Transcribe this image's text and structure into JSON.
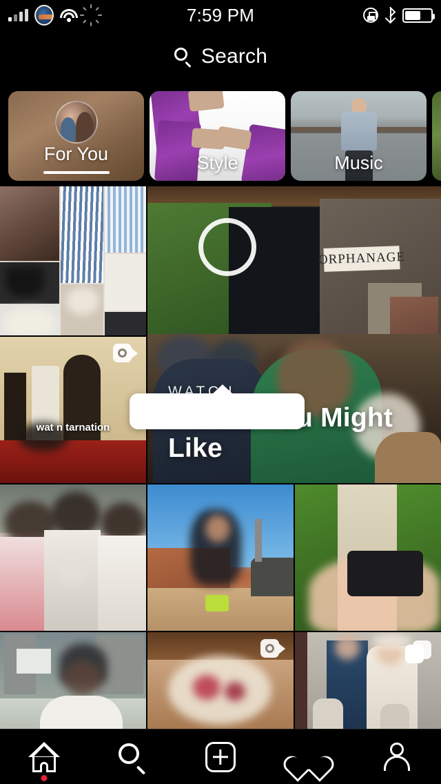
{
  "status_bar": {
    "time": "7:59 PM",
    "carrier_icon": "carrier-logo-mets",
    "signal_icon": "signal-bars-icon",
    "wifi_icon": "wifi-icon",
    "activity_icon": "activity-spinner-icon",
    "rotation_lock_icon": "rotation-lock-icon",
    "bluetooth_icon": "bluetooth-icon",
    "battery_icon": "battery-icon",
    "battery_level_percent": 62
  },
  "search": {
    "icon": "search-icon",
    "placeholder": "Search",
    "label": "Search"
  },
  "channels": {
    "items": [
      {
        "label": "For You",
        "active": true,
        "has_avatar": true,
        "avatar_name": "user-avatar"
      },
      {
        "label": "Style",
        "active": false,
        "has_avatar": false
      },
      {
        "label": "Music",
        "active": false,
        "has_avatar": false
      },
      {
        "label": "",
        "active": false,
        "has_avatar": false
      }
    ]
  },
  "tooltip": {
    "visible": true,
    "text": ""
  },
  "video_section": {
    "kicker": "WATCH",
    "title": "Videos You Might Like",
    "play_icon": "play-button-icon"
  },
  "grid": {
    "tiles": [
      {
        "name": "post-fashion-collage",
        "caption": "",
        "badge": "none",
        "alt": "fashion collage of striped shirt, white trousers, hat and handbag"
      },
      {
        "name": "post-dog-meme",
        "caption": "wat n tarnation",
        "badge": "video",
        "alt": "dog lying on red couch in hallway"
      },
      {
        "name": "post-video-hero",
        "caption": "",
        "badge": "none",
        "alt": "children stage performance with ORPHANAGE sign"
      },
      {
        "name": "post-group-photo",
        "caption": "",
        "badge": "none",
        "alt": "three people posing in crowd"
      },
      {
        "name": "post-desert-atv",
        "caption": "",
        "badge": "none",
        "alt": "woman posing in red rock desert"
      },
      {
        "name": "post-hand-object",
        "caption": "",
        "badge": "none",
        "alt": "hand holding black object over sidewalk"
      },
      {
        "name": "post-basketball-court",
        "caption": "",
        "badge": "none",
        "alt": "man in cap at a basketball court"
      },
      {
        "name": "post-dessert",
        "caption": "",
        "badge": "video",
        "alt": "powdered dessert with berries"
      },
      {
        "name": "post-royal-family",
        "caption": "",
        "badge": "carousel",
        "alt": "royal family christening portrait"
      }
    ],
    "stage_sign_text": "ORPHANAGE"
  },
  "tab_bar": {
    "items": [
      {
        "name": "home",
        "label": "Home",
        "icon": "home-icon",
        "badge_dot": true,
        "active": true
      },
      {
        "name": "search",
        "label": "Search",
        "icon": "search-icon",
        "badge_dot": false,
        "active": false
      },
      {
        "name": "add",
        "label": "New Post",
        "icon": "plus-square-icon",
        "badge_dot": false,
        "active": false
      },
      {
        "name": "activity",
        "label": "Activity",
        "icon": "heart-icon",
        "badge_dot": false,
        "active": false
      },
      {
        "name": "profile",
        "label": "Profile",
        "icon": "person-icon",
        "badge_dot": false,
        "active": false
      }
    ]
  },
  "colors": {
    "background": "#000000",
    "text_primary": "#ffffff",
    "badge_dot": "#e2253c",
    "tooltip_bg": "#ffffff"
  }
}
